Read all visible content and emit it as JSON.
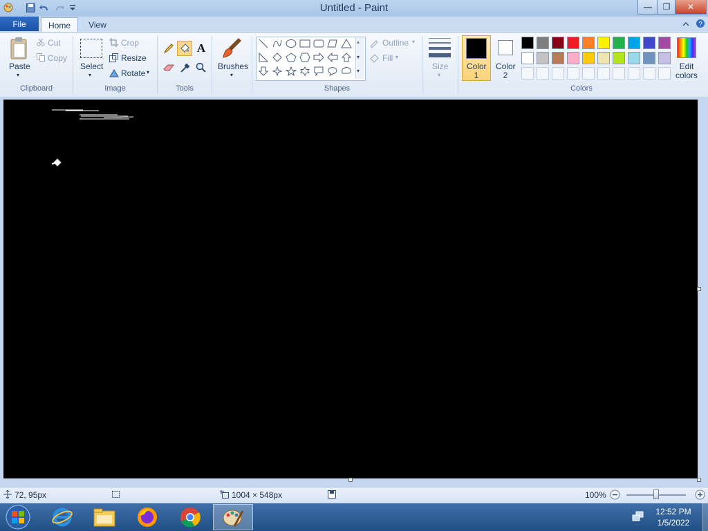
{
  "window": {
    "title": "Untitled - Paint",
    "controls": {
      "minimize": "—",
      "maximize": "❐",
      "close": "✕"
    }
  },
  "tabs": {
    "file": "File",
    "home": "Home",
    "view": "View"
  },
  "clipboard": {
    "paste": "Paste",
    "cut": "Cut",
    "copy": "Copy",
    "group": "Clipboard"
  },
  "image": {
    "select": "Select",
    "crop": "Crop",
    "resize": "Resize",
    "rotate": "Rotate",
    "group": "Image"
  },
  "tools": {
    "group": "Tools"
  },
  "brushes": {
    "label": "Brushes"
  },
  "shapes": {
    "outline": "Outline",
    "fill": "Fill",
    "group": "Shapes"
  },
  "size": {
    "label": "Size"
  },
  "colors": {
    "color1_line1": "Color",
    "color1_line2": "1",
    "color2_line1": "Color",
    "color2_line2": "2",
    "edit_line1": "Edit",
    "edit_line2": "colors",
    "group": "Colors",
    "color1_value": "#000000",
    "color2_value": "#ffffff",
    "palette_row1": [
      "#000000",
      "#7f7f7f",
      "#880015",
      "#ed1c24",
      "#ff7f27",
      "#fff200",
      "#22b14c",
      "#00a2e8",
      "#3f48cc",
      "#a349a4"
    ],
    "palette_row2": [
      "#ffffff",
      "#c3c3c3",
      "#b97a57",
      "#ffaec9",
      "#ffc90e",
      "#efe4b0",
      "#b5e61d",
      "#99d9ea",
      "#7092be",
      "#c8bfe7"
    ]
  },
  "status": {
    "cursor_pos": "72, 95px",
    "canvas_size": "1004 × 548px",
    "zoom": "100%",
    "zoom_level": 1.0
  },
  "taskbar": {
    "time": "12:52 PM",
    "date": "1/5/2022"
  }
}
